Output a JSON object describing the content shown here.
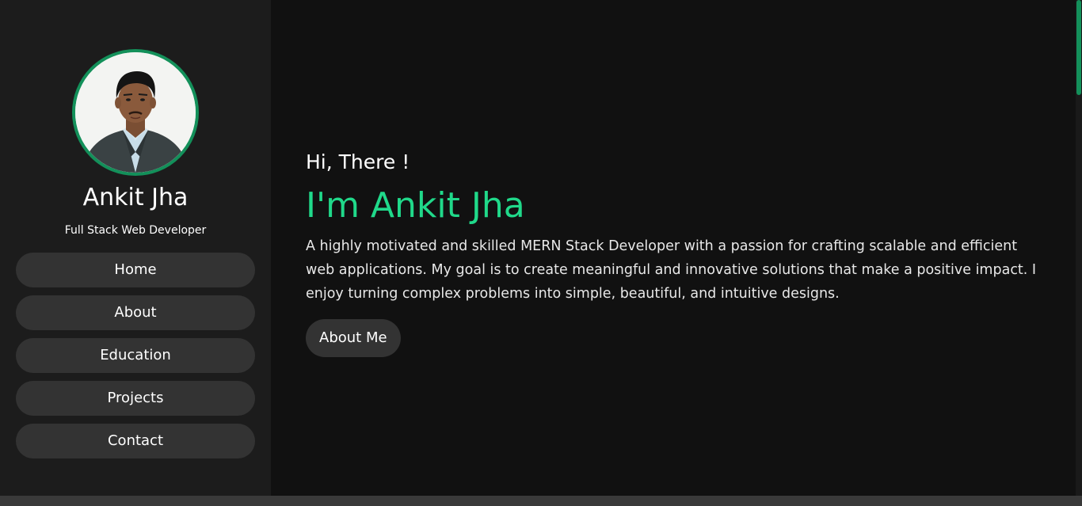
{
  "profile": {
    "name": "Ankit Jha",
    "role": "Full Stack Web Developer",
    "avatar_icon": "profile-photo"
  },
  "nav": {
    "items": [
      {
        "label": "Home"
      },
      {
        "label": "About"
      },
      {
        "label": "Education"
      },
      {
        "label": "Projects"
      },
      {
        "label": "Contact"
      }
    ]
  },
  "hero": {
    "greeting": "Hi, There !",
    "headline": "I'm Ankit Jha",
    "intro": "A highly motivated and skilled MERN Stack Developer with a passion for crafting scalable and efficient web applications. My goal is to create meaningful and innovative solutions that make a positive impact. I enjoy turning complex problems into simple, beautiful, and intuitive designs.",
    "cta_label": "About Me"
  },
  "colors": {
    "accent": "#20d98a",
    "avatar_border": "#13905a",
    "sidebar_bg": "#1c1c1c",
    "main_bg": "#111111",
    "button_bg": "#333333"
  }
}
